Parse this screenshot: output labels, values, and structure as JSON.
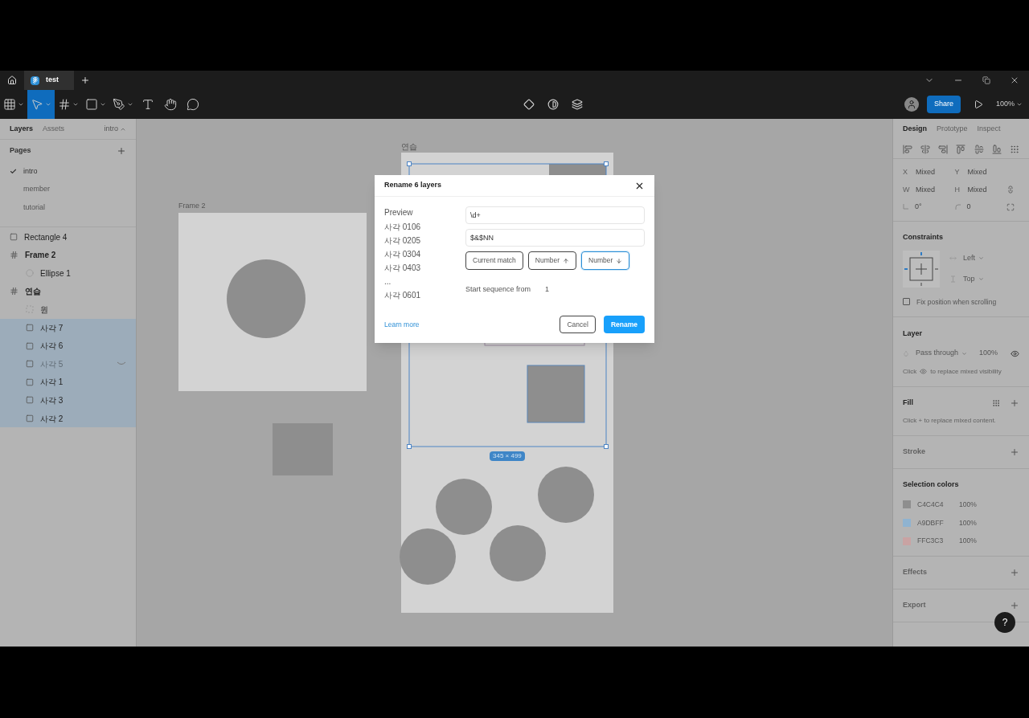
{
  "tab_bar": {
    "tabs": [
      {
        "label": "test",
        "selected": true
      }
    ]
  },
  "toolbar": {
    "tools": [
      {
        "kind": "menu",
        "selected": false
      },
      {
        "kind": "move",
        "selected": true
      },
      {
        "kind": "frame",
        "selected": false
      },
      {
        "kind": "shape",
        "selected": false
      },
      {
        "kind": "pen",
        "selected": false
      },
      {
        "kind": "text",
        "selected": false
      },
      {
        "kind": "hand",
        "selected": false
      },
      {
        "kind": "comment",
        "selected": false
      }
    ],
    "share": "Share",
    "zoom": "100%"
  },
  "left_panel": {
    "tabs": [
      {
        "label": "Layers",
        "selected": true
      },
      {
        "label": "Assets",
        "selected": false
      }
    ],
    "page_menu": "intro",
    "pages_title": "Pages",
    "pages": [
      {
        "label": "intro",
        "selected": true
      },
      {
        "label": "member",
        "selected": false
      },
      {
        "label": "tutorial",
        "selected": false
      }
    ],
    "layers": [
      {
        "name": "Rectangle 4",
        "kind": "rectangle",
        "selected": false,
        "hidden": false
      },
      {
        "name": "Frame 2",
        "kind": "frame",
        "selected": false,
        "hidden": false,
        "children": [
          {
            "name": "Ellipse 1",
            "kind": "ellipse",
            "selected": false,
            "hidden": false
          }
        ]
      },
      {
        "name": "연습",
        "kind": "frame",
        "selected": false,
        "hidden": false,
        "children": [
          {
            "name": "원",
            "kind": "dashed",
            "selected": false,
            "hidden": false
          },
          {
            "name": "사각 7",
            "kind": "rectangle",
            "selected": true,
            "hidden": false
          },
          {
            "name": "사각 6",
            "kind": "rectangle",
            "selected": true,
            "hidden": false
          },
          {
            "name": "사각 5",
            "kind": "rectangle",
            "selected": true,
            "hidden": true
          },
          {
            "name": "사각 1",
            "kind": "rectangle",
            "selected": true,
            "hidden": false
          },
          {
            "name": "사각 3",
            "kind": "rectangle",
            "selected": true,
            "hidden": false
          },
          {
            "name": "사각 2",
            "kind": "rectangle",
            "selected": true,
            "hidden": false
          }
        ]
      }
    ]
  },
  "canvas": {
    "frame_labels": [
      "Frame 2",
      "연습"
    ],
    "size_label": "345 × 499"
  },
  "dialog": {
    "title": "Rename 6 layers",
    "preview_title": "Preview",
    "preview": [
      "사각 0106",
      "사각 0205",
      "사각 0304",
      "사각 0403",
      "...",
      "사각 0601"
    ],
    "match_field": {
      "value": "\\d+"
    },
    "rename_field": {
      "value": "$&$NN"
    },
    "chips": [
      {
        "label": "Current match",
        "kind": "plain",
        "selected": false
      },
      {
        "label": "Number",
        "kind": "up",
        "selected": false
      },
      {
        "label": "Number",
        "kind": "down",
        "selected": true
      }
    ],
    "sequence_label": "Start sequence from",
    "sequence_value": "1",
    "learn_more": "Learn more",
    "cancel": "Cancel",
    "rename": "Rename"
  },
  "right_panel": {
    "tabs": [
      {
        "label": "Design",
        "selected": true
      },
      {
        "label": "Prototype",
        "selected": false
      },
      {
        "label": "Inspect",
        "selected": false
      }
    ],
    "properties": [
      {
        "label": "X",
        "value": "Mixed"
      },
      {
        "label": "Y",
        "value": "Mixed"
      },
      {
        "label": "W",
        "value": "Mixed"
      },
      {
        "label": "H",
        "value": "Mixed"
      },
      {
        "kind": "rotation",
        "value": "0°"
      },
      {
        "kind": "radius",
        "value": "0"
      }
    ],
    "constraints": {
      "title": "Constraints",
      "horizontal": "Left",
      "vertical": "Top",
      "fix_label": "Fix position when scrolling",
      "fix_checked": false
    },
    "layer": {
      "title": "Layer",
      "blend": "Pass through",
      "opacity": "100%",
      "hint_before": "Click",
      "hint_after": "to replace mixed visibility"
    },
    "fill": {
      "title": "Fill",
      "hint": "Click + to replace mixed content."
    },
    "stroke": {
      "title": "Stroke"
    },
    "selection_colors": {
      "title": "Selection colors",
      "items": [
        {
          "hex": "C4C4C4",
          "opacity": "100%",
          "color": "#8e8e8e"
        },
        {
          "hex": "A9DBFF",
          "opacity": "100%",
          "color": "#8fb3d0"
        },
        {
          "hex": "FFC3C3",
          "opacity": "100%",
          "color": "#c9a3a3"
        }
      ]
    },
    "effects": {
      "title": "Effects"
    },
    "export": {
      "title": "Export"
    },
    "help": "?"
  }
}
